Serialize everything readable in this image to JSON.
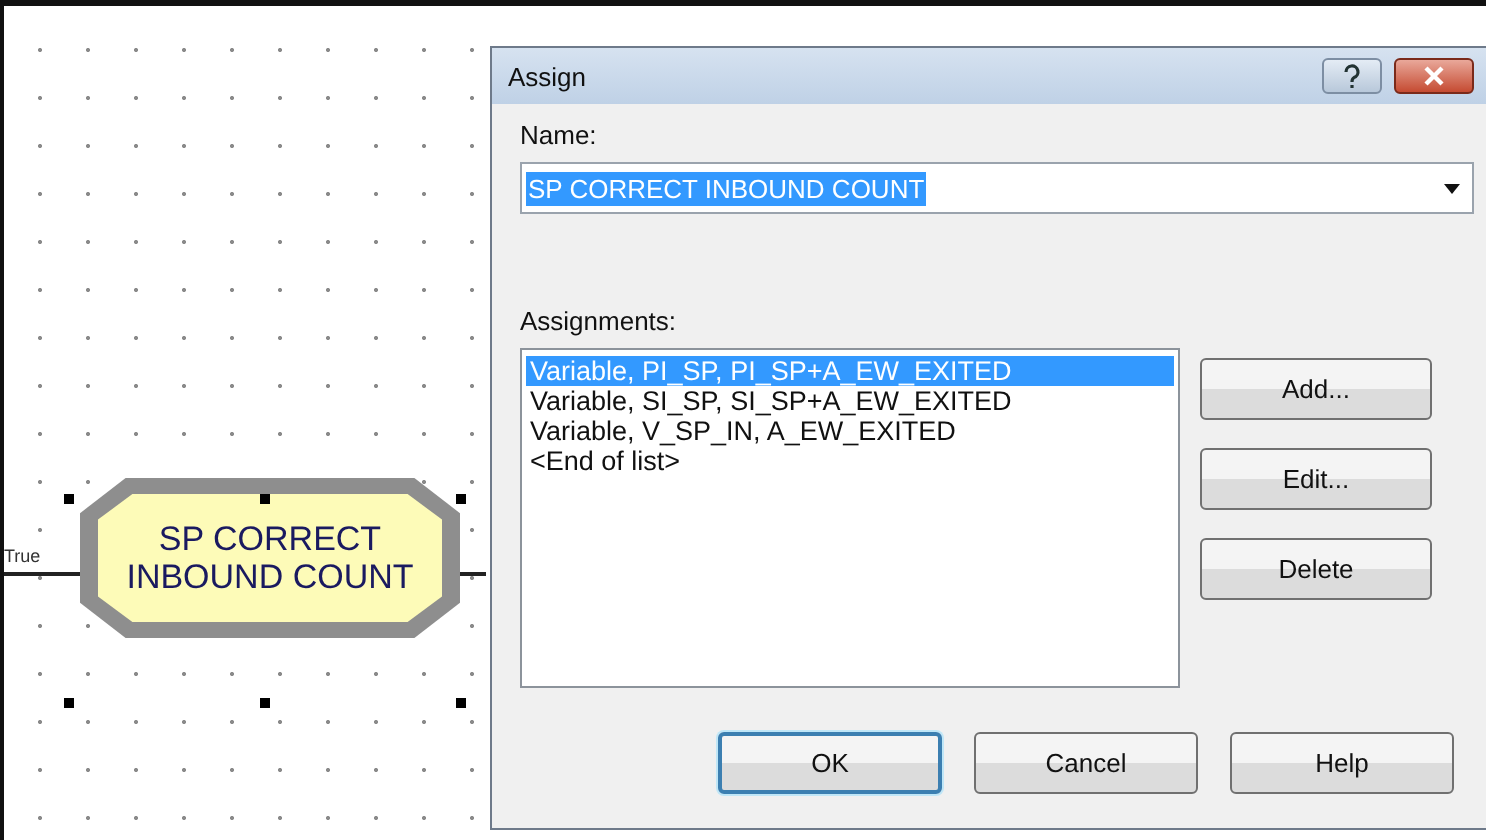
{
  "canvas": {
    "connector_label": "True",
    "module": {
      "label": "SP CORRECT INBOUND COUNT",
      "selected": true
    }
  },
  "dialog": {
    "title": "Assign",
    "name_field": {
      "label": "Name:",
      "value": "SP CORRECT INBOUND COUNT",
      "text_selected": true
    },
    "assignments": {
      "label": "Assignments:",
      "items": [
        {
          "text": "Variable, PI_SP, PI_SP+A_EW_EXITED",
          "selected": true
        },
        {
          "text": "Variable, SI_SP, SI_SP+A_EW_EXITED",
          "selected": false
        },
        {
          "text": "Variable, V_SP_IN, A_EW_EXITED",
          "selected": false
        },
        {
          "text": "<End of list>",
          "selected": false
        }
      ]
    },
    "side_buttons": [
      "Add...",
      "Edit...",
      "Delete"
    ],
    "bottom_buttons": [
      {
        "label": "OK",
        "default": true
      },
      {
        "label": "Cancel",
        "default": false
      },
      {
        "label": "Help",
        "default": false
      }
    ]
  }
}
